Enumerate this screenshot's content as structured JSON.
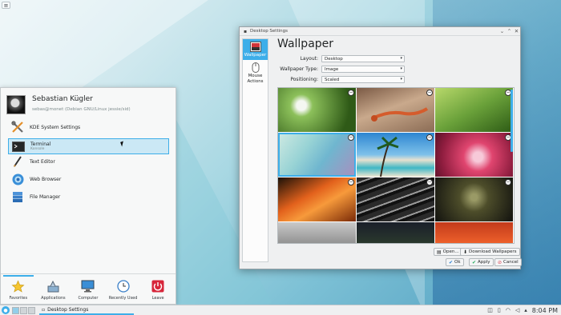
{
  "desktop": {
    "toolbox_icon": "hamburger-icon"
  },
  "window": {
    "title": "Desktop Settings",
    "sidebar": [
      {
        "label": "Wallpaper",
        "icon": "wallpaper-icon",
        "active": true
      },
      {
        "label": "Mouse Actions",
        "icon": "mouse-icon",
        "active": false
      }
    ],
    "heading": "Wallpaper",
    "fields": {
      "layout": {
        "label": "Layout:",
        "value": "Desktop"
      },
      "type": {
        "label": "Wallpaper Type:",
        "value": "Image"
      },
      "positioning": {
        "label": "Positioning:",
        "value": "Scaled"
      }
    },
    "buttons": {
      "open": "Open...",
      "download": "Download Wallpapers",
      "ok": "Ok",
      "apply": "Apply",
      "cancel": "Cancel"
    }
  },
  "launcher": {
    "user": {
      "name": "Sebastian Kügler",
      "host": "sebas@monet (Debian GNU/Linux jessie/sid)"
    },
    "favorites": [
      {
        "name": "KDE System Settings",
        "desc": "",
        "icon": "settings-tools-icon"
      },
      {
        "name": "Terminal",
        "desc": "Konsole",
        "icon": "terminal-icon",
        "highlighted": true
      },
      {
        "name": "Text Editor",
        "desc": "",
        "icon": "text-editor-icon"
      },
      {
        "name": "Web Browser",
        "desc": "",
        "icon": "web-browser-icon"
      },
      {
        "name": "File Manager",
        "desc": "",
        "icon": "file-manager-icon"
      }
    ],
    "tabs": [
      {
        "label": "Favorites",
        "icon": "star-icon",
        "active": true
      },
      {
        "label": "Applications",
        "icon": "applications-icon"
      },
      {
        "label": "Computer",
        "icon": "computer-icon"
      },
      {
        "label": "Recently Used",
        "icon": "recent-icon"
      },
      {
        "label": "Leave",
        "icon": "power-icon"
      }
    ]
  },
  "panel": {
    "task": "Desktop Settings",
    "clock": "8:04 PM"
  }
}
